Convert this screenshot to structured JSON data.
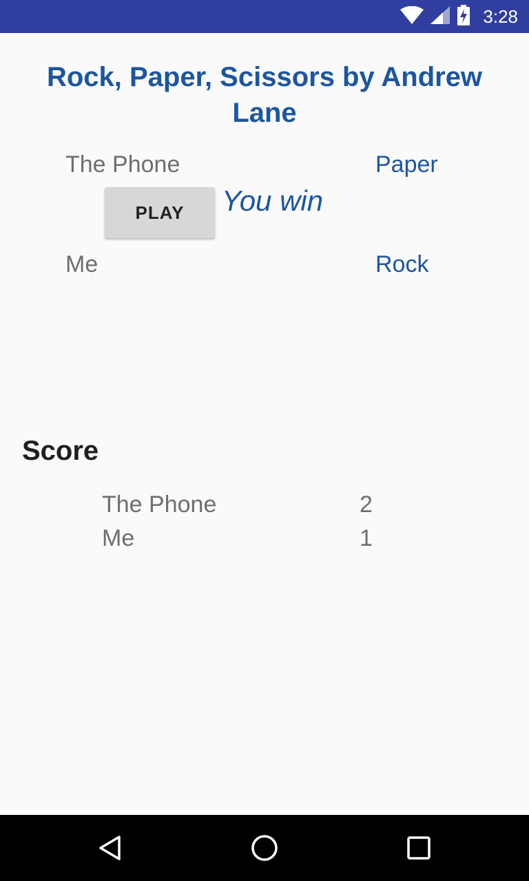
{
  "status_bar": {
    "time": "3:28",
    "icons": [
      "wifi-icon",
      "signal-icon",
      "battery-charging-icon"
    ]
  },
  "app": {
    "title": "Rock, Paper, Scissors by Andrew Lane"
  },
  "round": {
    "phone_label": "The Phone",
    "phone_choice": "Paper",
    "me_label": "Me",
    "me_choice": "Rock",
    "play_button": "PLAY",
    "result": "You win"
  },
  "score": {
    "heading": "Score",
    "rows": [
      {
        "name": "The Phone",
        "value": "2"
      },
      {
        "name": "Me",
        "value": "1"
      }
    ]
  },
  "nav_bar": {
    "buttons": [
      "back-icon",
      "home-icon",
      "recents-icon"
    ]
  },
  "colors": {
    "status_bar": "#303f9f",
    "accent_blue": "#1c56a0",
    "background": "#fafafa",
    "button": "#d6d7d7"
  }
}
